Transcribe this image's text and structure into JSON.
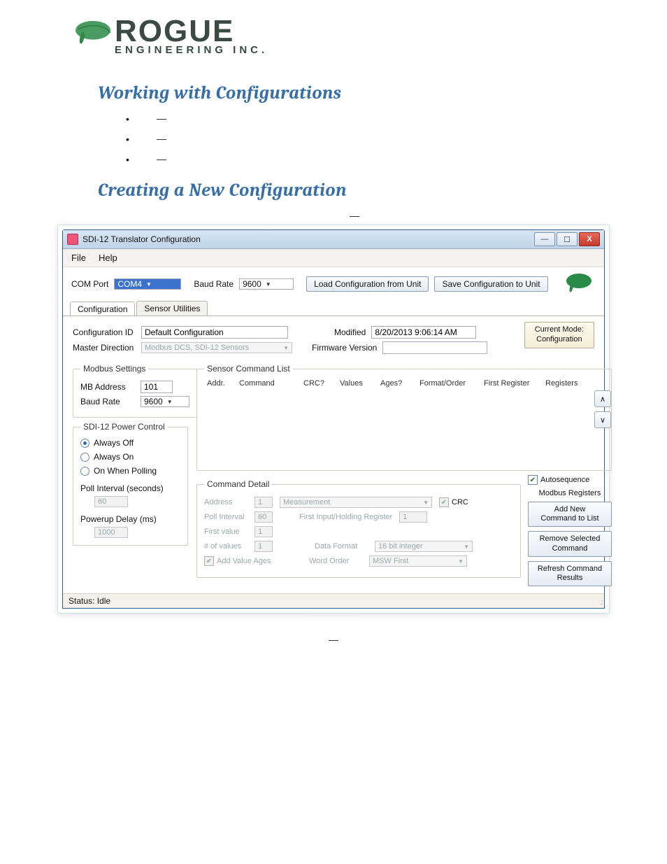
{
  "logo": {
    "brand_top": "ROGUE",
    "brand_bottom": "ENGINEERING INC."
  },
  "sections": {
    "working_title": "Working with Configurations",
    "creating_title": "Creating a New Configuration"
  },
  "win": {
    "title": "SDI-12 Translator Configuration",
    "menu": {
      "file": "File",
      "help": "Help"
    },
    "toolbar": {
      "com_port_label": "COM Port",
      "com_port_value": "COM4",
      "baud_label": "Baud Rate",
      "baud_value": "9600",
      "load_btn": "Load Configuration from Unit",
      "save_btn": "Save Configuration to Unit"
    },
    "tabs": {
      "config": "Configuration",
      "sensor": "Sensor Utilities"
    },
    "config": {
      "config_id_label": "Configuration ID",
      "config_id_value": "Default Configuration",
      "modified_label": "Modified",
      "modified_value": "8/20/2013 9:06:14 AM",
      "master_dir_label": "Master Direction",
      "master_dir_value": "Modbus DCS, SDI-12 Sensors",
      "fw_label": "Firmware Version",
      "mode_badge_l1": "Current Mode:",
      "mode_badge_l2": "Configuration"
    },
    "modbus": {
      "legend": "Modbus Settings",
      "addr_label": "MB Address",
      "addr_value": "101",
      "baud_label": "Baud Rate",
      "baud_value": "9600"
    },
    "power": {
      "legend": "SDI-12 Power Control",
      "opt_off": "Always Off",
      "opt_on": "Always On",
      "opt_poll": "On When Polling",
      "poll_int_label": "Poll Interval (seconds)",
      "poll_int_value": "60",
      "pu_delay_label": "Powerup Delay (ms)",
      "pu_delay_value": "1000"
    },
    "sensor_list": {
      "legend": "Sensor Command List",
      "h_addr": "Addr.",
      "h_cmd": "Command",
      "h_crc": "CRC?",
      "h_vals": "Values",
      "h_ages": "Ages?",
      "h_fmt": "Format/Order",
      "h_first": "First Register",
      "h_regs": "Registers",
      "up": "∧",
      "down": "∨"
    },
    "detail": {
      "legend": "Command Detail",
      "addr_label": "Address",
      "addr_value": "1",
      "meas_value": "Measurement",
      "crc_label": "CRC",
      "poll_label": "Poll Interval",
      "poll_value": "60",
      "first_reg_label": "First Input/Holding Register",
      "first_reg_value": "1",
      "firstval_label": "First value",
      "firstval_value": "1",
      "numvals_label": "# of values",
      "numvals_value": "1",
      "datafmt_label": "Data Format",
      "datafmt_value": "16 bit integer",
      "wordorder_label": "Word Order",
      "wordorder_value": "MSW First",
      "addages_label": "Add Value Ages"
    },
    "side": {
      "autoseq_label": "Autosequence",
      "autoseq_sub": "Modbus Registers",
      "add_btn": "Add New\nCommand to List",
      "remove_btn": "Remove Selected\nCommand",
      "refresh_btn": "Refresh Command\nResults"
    },
    "status": "Status: Idle"
  }
}
